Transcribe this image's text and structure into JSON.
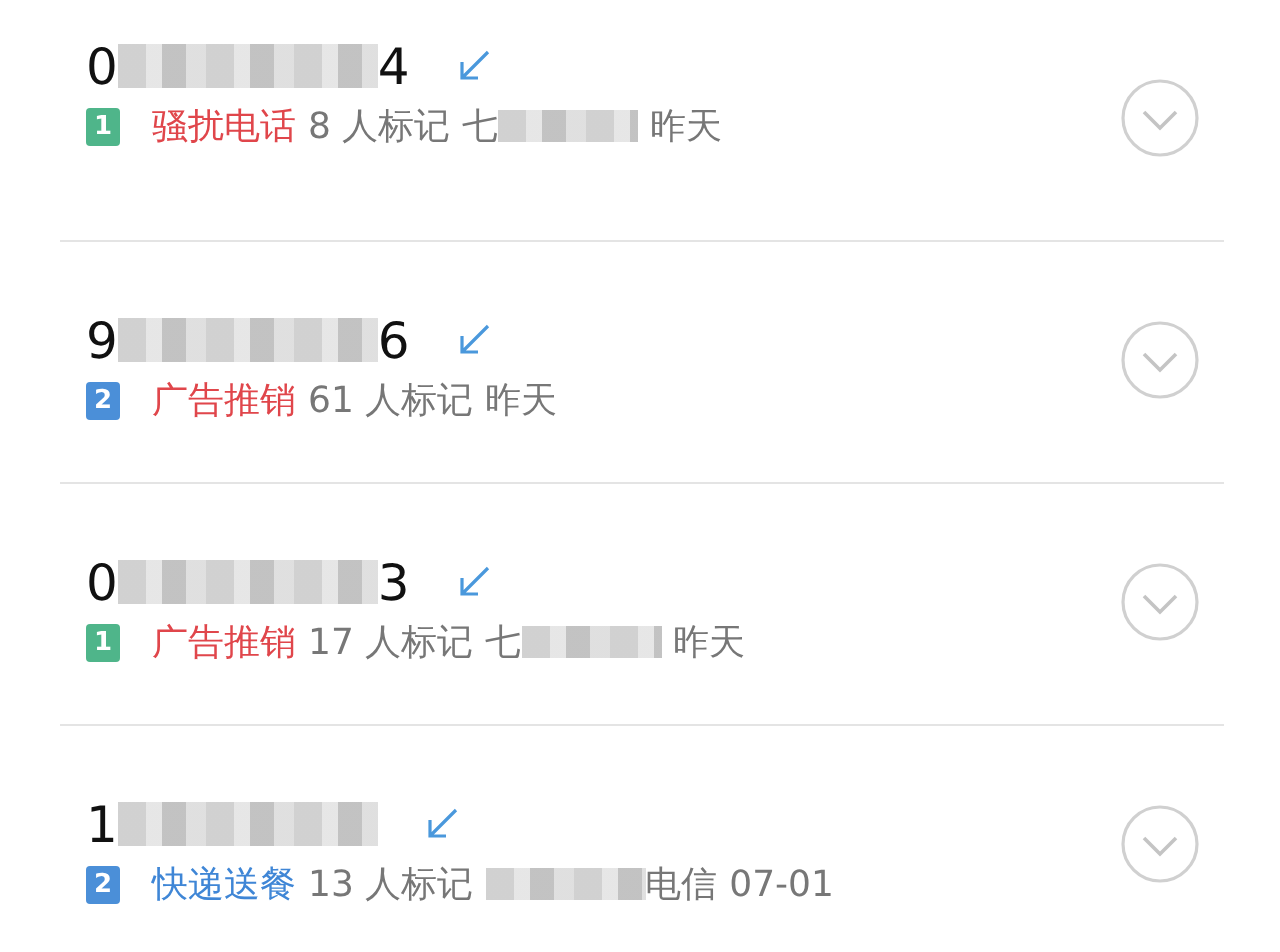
{
  "calls": [
    {
      "number_start": "0",
      "number_redacted": true,
      "number_end": "4",
      "badge": {
        "text": "1",
        "color": "#4fb58a"
      },
      "tag": {
        "text": "骚扰电话",
        "color": "#e0464b"
      },
      "count": "8 人标记",
      "location": {
        "start": "七",
        "redacted": true
      },
      "time": "昨天"
    },
    {
      "number_start": "9",
      "number_redacted": true,
      "number_end": "6",
      "badge": {
        "text": "2",
        "color": "#4b8fd8"
      },
      "tag": {
        "text": "广告推销",
        "color": "#e0464b"
      },
      "count": "61 人标记",
      "location": {
        "redacted": false
      },
      "time": "昨天"
    },
    {
      "number_start": "0",
      "number_redacted": true,
      "number_end": "3",
      "badge": {
        "text": "1",
        "color": "#4fb58a"
      },
      "tag": {
        "text": "广告推销",
        "color": "#e0464b"
      },
      "count": "17 人标记",
      "location": {
        "start": "七",
        "redacted": true
      },
      "time": "昨天"
    },
    {
      "number_start": "1",
      "number_redacted": true,
      "badge": {
        "text": "2",
        "color": "#4b8fd8"
      },
      "tag": {
        "text": "快递送餐",
        "color": "#3f86d6"
      },
      "count": "13 人标记",
      "location": {
        "redacted": true,
        "end": "电信"
      },
      "time": "07-01"
    }
  ]
}
